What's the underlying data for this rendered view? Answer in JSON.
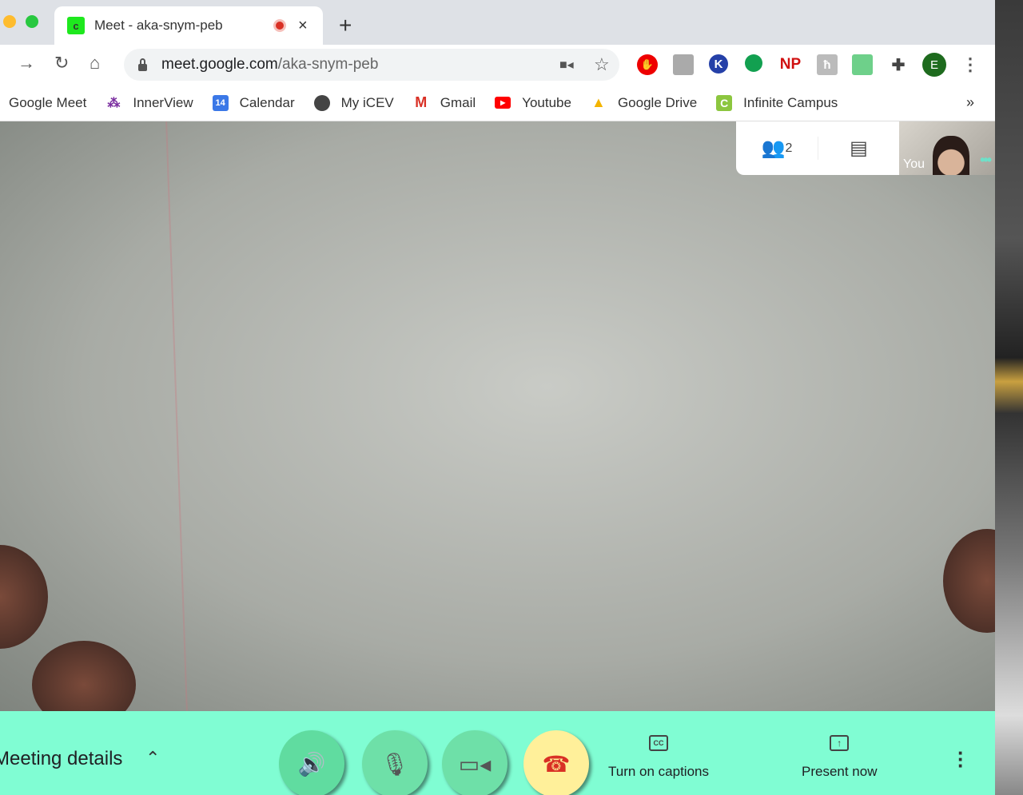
{
  "tab": {
    "title": "Meet - aka-snym-peb",
    "favicon_letter": "c",
    "new_tab": "+",
    "close": "×"
  },
  "toolbar": {
    "url_host": "meet.google.com",
    "url_path": "/aka-snym-peb",
    "profile_initial": "E",
    "ext_np": "NP",
    "ext_k": "K"
  },
  "bookmarks": [
    {
      "label": "Google Meet"
    },
    {
      "label": "InnerView"
    },
    {
      "label": "Calendar",
      "icon_text": "14"
    },
    {
      "label": "My iCEV"
    },
    {
      "label": "Gmail",
      "icon_text": "M"
    },
    {
      "label": "Youtube"
    },
    {
      "label": "Google Drive"
    },
    {
      "label": "Infinite Campus",
      "icon_text": "C"
    }
  ],
  "bookmarks_more": "»",
  "meet": {
    "participants_count": "2",
    "self_label": "You",
    "meeting_details": "Meeting details",
    "captions": "Turn on captions",
    "present": "Present now",
    "cc_icon": "CC"
  },
  "colors": {
    "bottom_bar": "#80fdd3",
    "end_call": "#fff09a",
    "control_green": "#6ee0a8"
  }
}
